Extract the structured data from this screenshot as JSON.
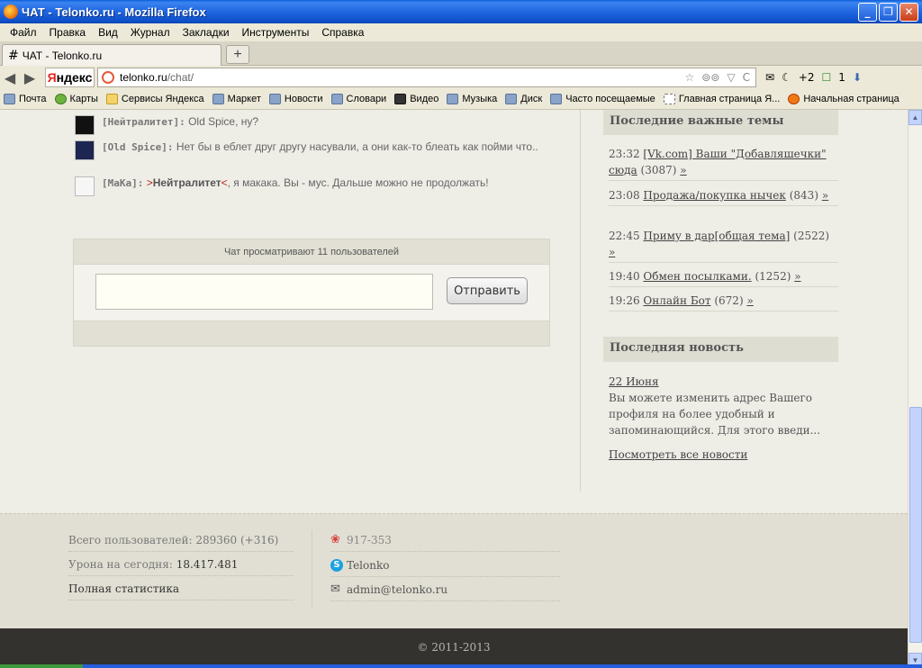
{
  "window": {
    "title": "ЧАТ - Telonko.ru - Mozilla Firefox",
    "minimize": "_",
    "maximize": "❐",
    "close": "✕"
  },
  "menu": [
    "Файл",
    "Правка",
    "Вид",
    "Журнал",
    "Закладки",
    "Инструменты",
    "Справка"
  ],
  "tab": {
    "title": "ЧАТ - Telonko.ru",
    "newtab": "+"
  },
  "nav": {
    "back": "◀",
    "forward": "▶",
    "yandex_first": "Я",
    "yandex_rest": "ндекс",
    "url_host": "telonko.ru",
    "url_path": "/chat/",
    "star": "☆",
    "glasses": "⊚⊚",
    "dropdown": "▽",
    "reload": "C",
    "mail_icon": "✉",
    "moon_icon": "☾",
    "moon_count": "+2",
    "counter_icon": "☐",
    "counter_value": "1",
    "download_icon": "⬇"
  },
  "bookmarks": [
    "Почта",
    "Карты",
    "Сервисы Яндекса",
    "Маркет",
    "Новости",
    "Словари",
    "Видео",
    "Музыка",
    "Диск",
    "Часто посещаемые",
    "Главная страница Я...",
    "Начальная страница"
  ],
  "chat": {
    "messages": [
      {
        "nick": "[Нейтралитет]:",
        "text": "Old Spice, ну?"
      },
      {
        "nick": "[Old Spice]:",
        "text": "Нет бы в еблет друг другу насували, а они как-то блеать как пойми что.."
      },
      {
        "nick": "[MaKa]:",
        "to_open": ">",
        "to_name": "Нейтралитет",
        "to_close": "<",
        "text": ", я макака. Вы - мус. Дальше можно не продолжать!"
      }
    ],
    "viewers": "Чат просматривают 11 пользователей",
    "input_value": "",
    "send_label": "Отправить"
  },
  "topics": {
    "header": "Последние важные темы",
    "items": [
      {
        "time": "23:32",
        "title": "[Vk.com] Ваши \"Добавляшечки\" сюда",
        "count": "(3087)",
        "more": "»"
      },
      {
        "time": "23:08",
        "title": "Продажа/покупка нычек",
        "count": "(843)",
        "more": "»"
      },
      {
        "time": "22:45",
        "title": "Приму в дар[общая тема]",
        "count": "(2522)",
        "more": "»"
      },
      {
        "time": "19:40",
        "title": "Обмен посылками.",
        "count": "(1252)",
        "more": "»"
      },
      {
        "time": "19:26",
        "title": "Онлайн Бот",
        "count": "(672)",
        "more": "»"
      }
    ]
  },
  "news": {
    "header": "Последняя новость",
    "date": "22 Июня",
    "text": "Вы можете изменить адрес Вашего профиля на более удобный и запоминающийся. Для этого введи...",
    "all_link": "Посмотреть все новости"
  },
  "footer": {
    "users_label": "Всего пользователей:",
    "users_value": "289360 (+316)",
    "harvest_label": "Урона на сегодня:",
    "harvest_value": "18.417.481",
    "full_stats": "Полная статистика",
    "icq_icon": "❀",
    "icq": "917-353",
    "skype_icon": "S",
    "skype": "Telonko",
    "mail_icon": "✉",
    "email": "admin@telonko.ru",
    "copyright": "© 2011-2013"
  },
  "scroll": {
    "up": "▲",
    "down": "▼"
  },
  "colors": {
    "title_bar": "#1f66e0",
    "accent_red": "#c0201a",
    "footer_dark": "#33322f"
  }
}
